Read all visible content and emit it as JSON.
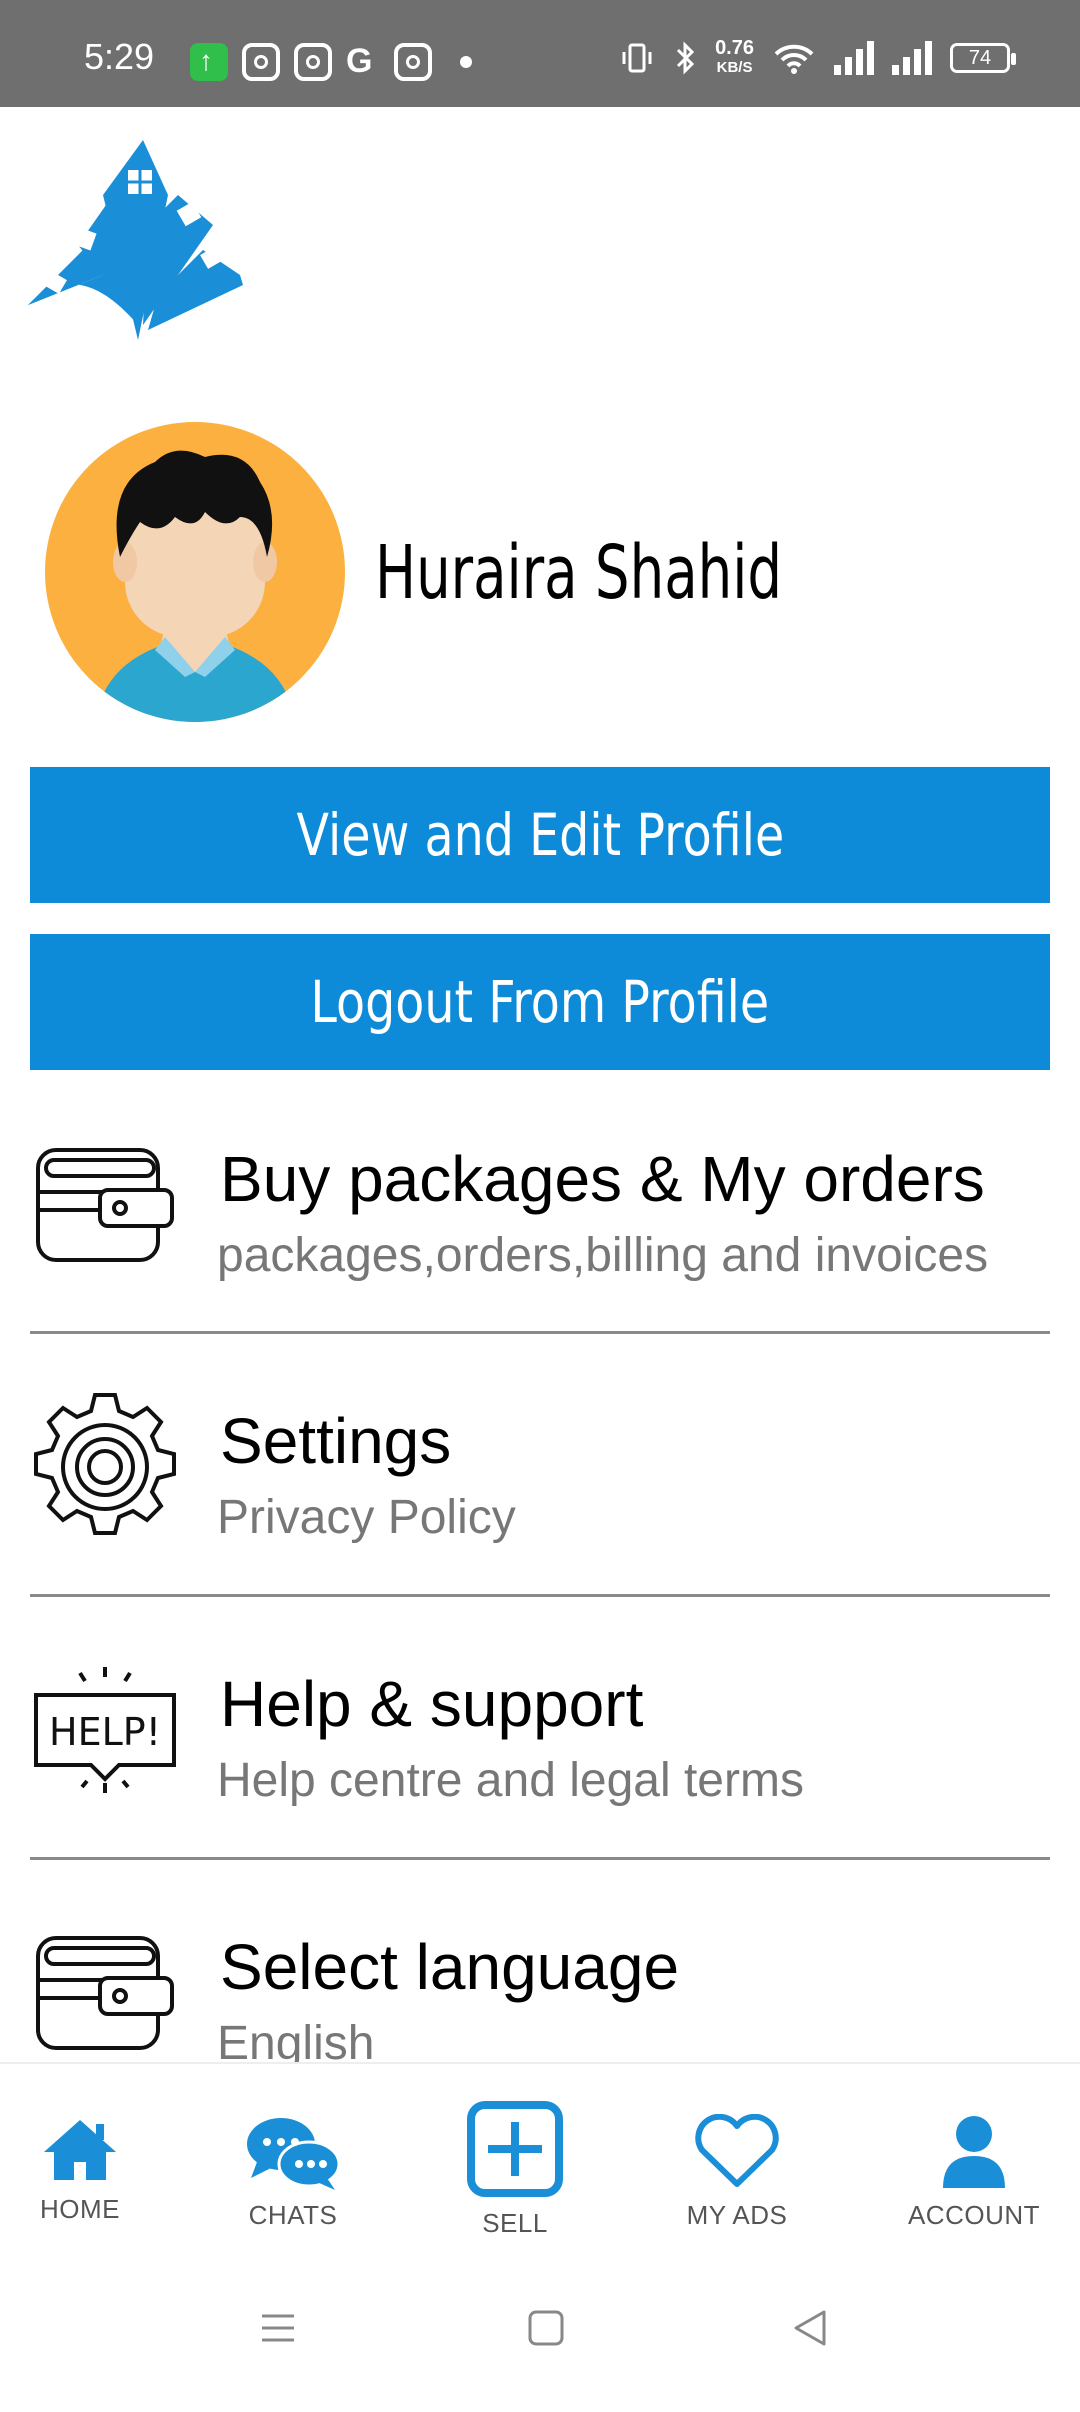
{
  "status_bar": {
    "time": "5:29",
    "speed_value": "0.76",
    "speed_unit": "KB/S",
    "battery": "74"
  },
  "profile": {
    "name": "Huraira Shahid"
  },
  "buttons": {
    "edit_profile": "View and Edit Profile",
    "logout": "Logout From Profile"
  },
  "menu": [
    {
      "title": "Buy packages & My orders",
      "subtitle": "packages,orders,billing and invoices",
      "icon": "wallet-icon"
    },
    {
      "title": "Settings",
      "subtitle": "Privacy Policy",
      "icon": "gear-icon"
    },
    {
      "title": "Help & support",
      "subtitle": "Help centre and legal terms",
      "icon": "help-bubble-icon"
    },
    {
      "title": "Select language",
      "subtitle": "English",
      "icon": "wallet-icon"
    }
  ],
  "bottom_nav": [
    {
      "label": "HOME",
      "icon": "home-icon"
    },
    {
      "label": "CHATS",
      "icon": "chat-icon"
    },
    {
      "label": "SELL",
      "icon": "plus-box-icon"
    },
    {
      "label": "MY ADS",
      "icon": "heart-icon"
    },
    {
      "label": "ACCOUNT",
      "icon": "user-icon"
    }
  ],
  "colors": {
    "primary": "#0e8bd8",
    "status_bar": "#6f6f6f",
    "avatar_bg": "#fbb040"
  }
}
